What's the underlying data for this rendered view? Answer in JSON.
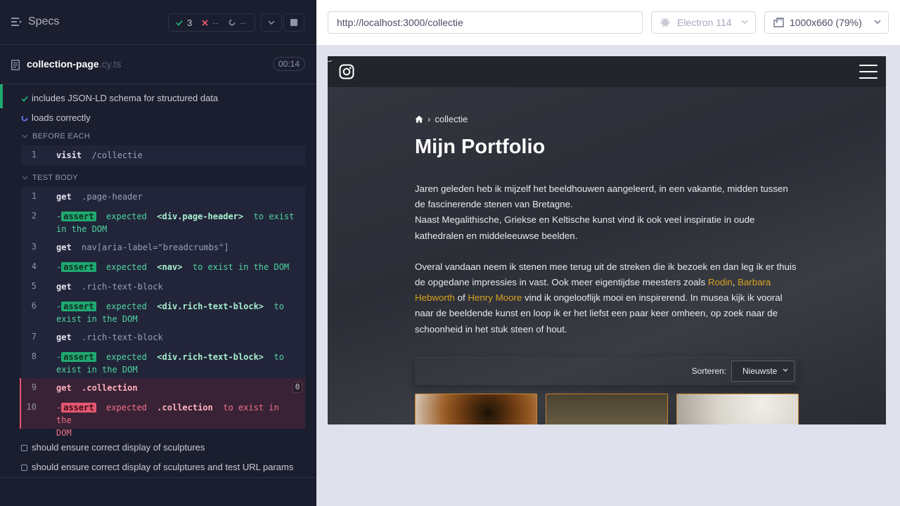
{
  "reporter": {
    "specs_label": "Specs",
    "stats": {
      "passed": "3",
      "failed": "--",
      "pending": "--"
    },
    "spec": {
      "name": "collection-page",
      "ext": ".cy.ts",
      "duration": "00:14"
    },
    "tests": [
      {
        "title": "includes JSON-LD schema for structured data",
        "state": "passed"
      },
      {
        "title": "loads correctly",
        "state": "running"
      }
    ],
    "before_each_label": "BEFORE EACH",
    "test_body_label": "TEST BODY",
    "before_cmd": {
      "num": "1",
      "name": "visit",
      "arg": "/collectie"
    },
    "commands": [
      {
        "num": "1",
        "name": "get",
        "arg": ".page-header"
      },
      {
        "num": "2",
        "tag": "assert",
        "pre": "expected",
        "subject": "<div.page-header>",
        "post": "to exist",
        "cont": "in the DOM"
      },
      {
        "num": "3",
        "name": "get",
        "arg": "nav[aria-label=\"breadcrumbs\"]"
      },
      {
        "num": "4",
        "tag": "assert",
        "pre": "expected",
        "subject": "<nav>",
        "post": "to exist in the DOM"
      },
      {
        "num": "5",
        "name": "get",
        "arg": ".rich-text-block"
      },
      {
        "num": "6",
        "tag": "assert",
        "pre": "expected",
        "subject": "<div.rich-text-block>",
        "post": "to",
        "cont": "exist in the DOM"
      },
      {
        "num": "7",
        "name": "get",
        "arg": ".rich-text-block"
      },
      {
        "num": "8",
        "tag": "assert",
        "pre": "expected",
        "subject": "<div.rich-text-block>",
        "post": "to",
        "cont": "exist in the DOM"
      },
      {
        "num": "9",
        "name": "get",
        "arg": ".collection",
        "badge": "0"
      },
      {
        "num": "10",
        "tag": "assert",
        "pre": "expected",
        "subject": ".collection",
        "post": "to exist in the",
        "cont": "DOM"
      }
    ],
    "pending_tests": [
      "should ensure correct display of sculptures",
      "should ensure correct display of sculptures and test URL params"
    ]
  },
  "aut_header": {
    "url": "http://localhost:3000/collectie",
    "browser": "Electron 114",
    "viewport": "1000x660",
    "scale": "(79%)"
  },
  "site": {
    "crumb": "collectie",
    "title": "Mijn Portfolio",
    "p1_line1": "Jaren geleden heb ik mijzelf het beeldhouwen aangeleerd, in een vakantie, midden tussen de fascinerende stenen van Bretagne.",
    "p1_line2": "Naast Megalithische, Griekse en Keltische kunst vind ik ook veel inspiratie in oude kathedralen en middeleeuwse beelden.",
    "p2_a": "Overal vandaan neem ik stenen mee terug uit de streken die ik bezoek en dan leg ik er thuis de opgedane impressies in vast. Ook meer eigentijdse meesters zoals ",
    "link1": "Rodin",
    "comma": ",",
    "link2": "Barbara Hebworth",
    "of": " of ",
    "link3": "Henry Moore",
    "p2_b": " vind ik ongelooflijk mooi en inspirerend. In musea kijk ik vooral naar de beeldende kunst en loop ik er het liefst een paar keer omheen, op zoek naar de schoonheid in het stuk steen of hout.",
    "sort_label": "Sorteren:",
    "sort_value": "Nieuwste"
  },
  "colors": {
    "pass": "#1fa971",
    "fail": "#e45770",
    "link": "#d9a21f"
  }
}
